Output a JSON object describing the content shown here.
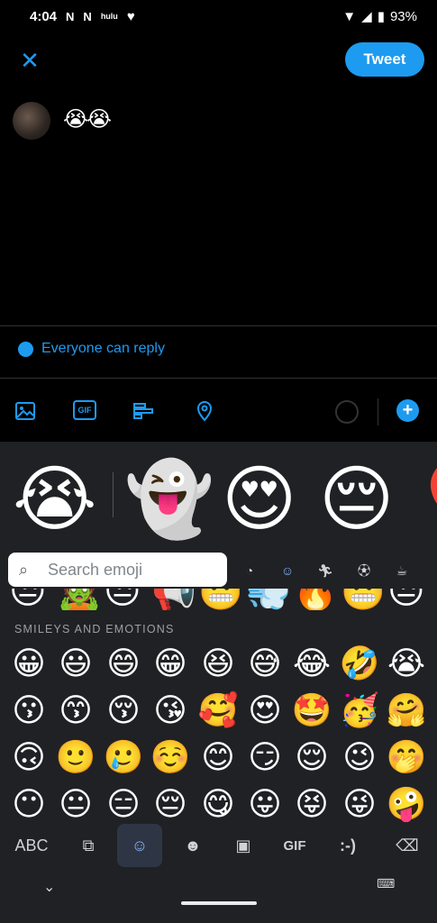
{
  "status_bar": {
    "time": "4:04",
    "left_icons": [
      "N",
      "N",
      "hulu"
    ],
    "battery": "93%"
  },
  "compose": {
    "tweet_button": "Tweet",
    "text": "😭😭"
  },
  "reply": {
    "label": "Everyone can reply"
  },
  "toolbar": {
    "gif_label": "GIF",
    "add_label": "+"
  },
  "keyboard": {
    "featured": [
      "😭",
      "👻",
      "😍",
      "😔",
      "🎈"
    ],
    "search_placeholder": "Search emoji",
    "category_icons": [
      "clock-icon",
      "smiley-icon",
      "person-icon",
      "activity-icon",
      "coffee-icon"
    ],
    "peek_row": [
      "😒",
      "🧟",
      "😒",
      "📢",
      "😬",
      "💨",
      "🔥",
      "😬",
      "😒"
    ],
    "section_title": "SMILEYS AND EMOTIONS",
    "grid": [
      [
        "😀",
        "😃",
        "😄",
        "😁",
        "😆",
        "😅",
        "😂",
        "🤣",
        "😭"
      ],
      [
        "😗",
        "😙",
        "😚",
        "😘",
        "🥰",
        "😍",
        "🤩",
        "🥳",
        "🤗"
      ],
      [
        "🙃",
        "🙂",
        "🥲",
        "☺️",
        "😊",
        "😏",
        "😌",
        "😉",
        "🤭"
      ],
      [
        "😶",
        "😐",
        "😑",
        "😔",
        "😋",
        "😛",
        "😝",
        "😜",
        "🤪"
      ]
    ],
    "bottom_keys": {
      "abc": "ABC",
      "gif": "GIF",
      "emoticon": ":-)"
    }
  }
}
